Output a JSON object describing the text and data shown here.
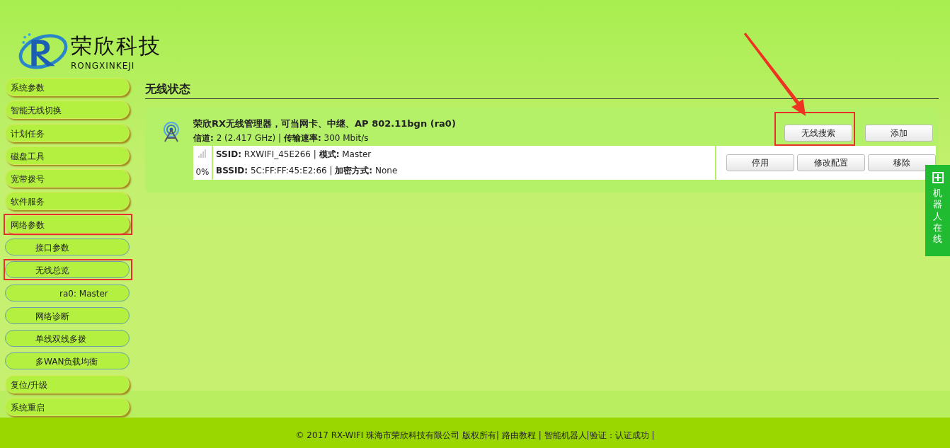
{
  "logo": {
    "name": "荣欣科技",
    "subtitle": "RONGXINKEJI"
  },
  "sidebar": {
    "items": [
      {
        "label": "系统参数",
        "highlighted": false
      },
      {
        "label": "智能无线切换",
        "highlighted": false
      },
      {
        "label": "计划任务",
        "highlighted": false
      },
      {
        "label": "磁盘工具",
        "highlighted": false
      },
      {
        "label": "宽带拨号",
        "highlighted": false
      },
      {
        "label": "软件服务",
        "highlighted": false
      },
      {
        "label": "网络参数",
        "highlighted": true,
        "children": [
          {
            "label": "接口参数",
            "highlighted": false
          },
          {
            "label": "无线总览",
            "highlighted": true,
            "children": [
              {
                "label": "ra0: Master",
                "highlighted": false
              }
            ]
          },
          {
            "label": "网络诊断",
            "highlighted": false
          },
          {
            "label": "单线双线多拨",
            "highlighted": false
          },
          {
            "label": "多WAN负载均衡",
            "highlighted": false
          }
        ]
      },
      {
        "label": "复位/升级",
        "highlighted": false
      },
      {
        "label": "系统重启",
        "highlighted": false
      }
    ]
  },
  "section_title": "无线状态",
  "device": {
    "title": "荣欣RX无线管理器，可当网卡、中继、AP 802.11bgn (ra0)",
    "info": "**信道:** 2 (2.417 GHz) | **传输速率:** 300 Mbit/s",
    "buttons": [
      {
        "label": "无线搜索",
        "highlighted": true
      },
      {
        "label": "添加",
        "highlighted": false
      }
    ],
    "networks": [
      {
        "signal": "0%",
        "line_1": "**SSID:** RXWIFI_45E266 | **模式:** Master",
        "line_2": "**BSSID:** 5C:FF:FF:45:E2:66 | **加密方式:** None",
        "buttons": [
          {
            "label": "停用"
          },
          {
            "label": "修改配置"
          },
          {
            "label": "移除"
          }
        ]
      }
    ]
  },
  "side_widget": {
    "label": "机器人在线"
  },
  "footer": "© 2017 RX-WIFI 珠海市荣欣科技有限公司 版权所有| 路由教程 | 智能机器人|验证：认证成功 |"
}
